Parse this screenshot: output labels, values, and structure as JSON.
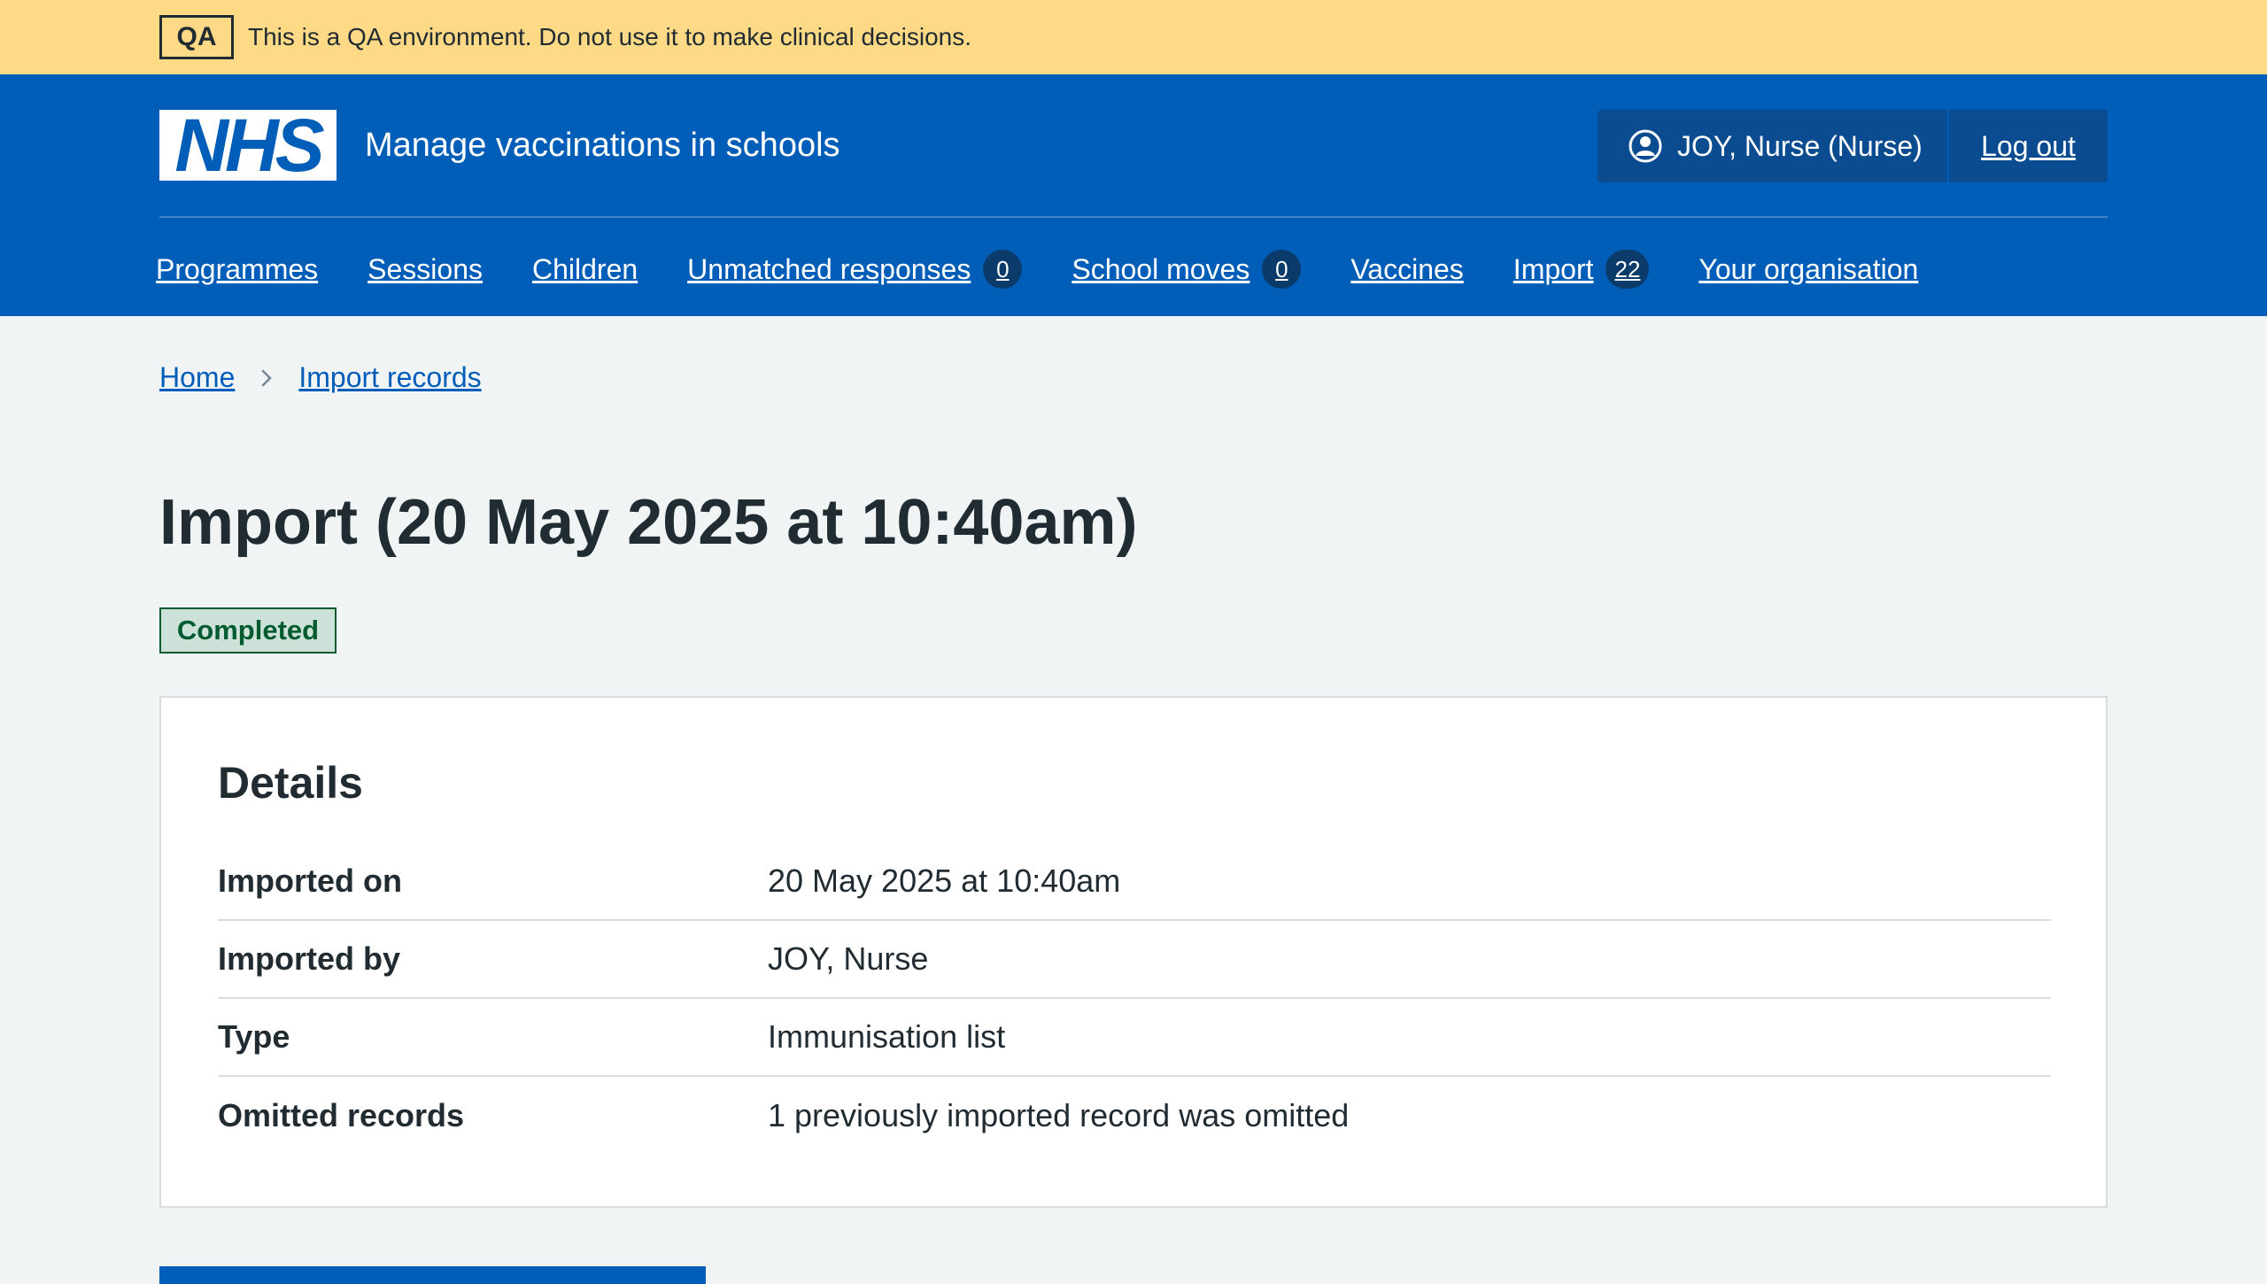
{
  "qa_banner": {
    "tag": "QA",
    "text": "This is a QA environment. Do not use it to make clinical decisions."
  },
  "header": {
    "logo_text": "NHS",
    "service_name": "Manage vaccinations in schools",
    "account_user": "JOY, Nurse (Nurse)",
    "logout_label": "Log out"
  },
  "nav": {
    "programmes": "Programmes",
    "sessions": "Sessions",
    "children": "Children",
    "unmatched": "Unmatched responses",
    "unmatched_count": "0",
    "school_moves": "School moves",
    "school_moves_count": "0",
    "vaccines": "Vaccines",
    "import": "Import",
    "import_count": "22",
    "organisation": "Your organisation"
  },
  "breadcrumb": {
    "home": "Home",
    "import_records": "Import records"
  },
  "page": {
    "title": "Import (20 May 2025 at 10:40am)",
    "status": "Completed"
  },
  "details": {
    "heading": "Details",
    "rows": [
      {
        "key": "Imported on",
        "value": "20 May 2025 at 10:40am"
      },
      {
        "key": "Imported by",
        "value": "JOY, Nurse"
      },
      {
        "key": "Type",
        "value": "Immunisation list"
      },
      {
        "key": "Omitted records",
        "value": "1 previously imported record was omitted"
      }
    ]
  },
  "colors": {
    "nhs_blue": "#005eb8",
    "qa_yellow": "#ffda86",
    "success_green": "#005a30",
    "success_bg": "#cce2d8"
  }
}
